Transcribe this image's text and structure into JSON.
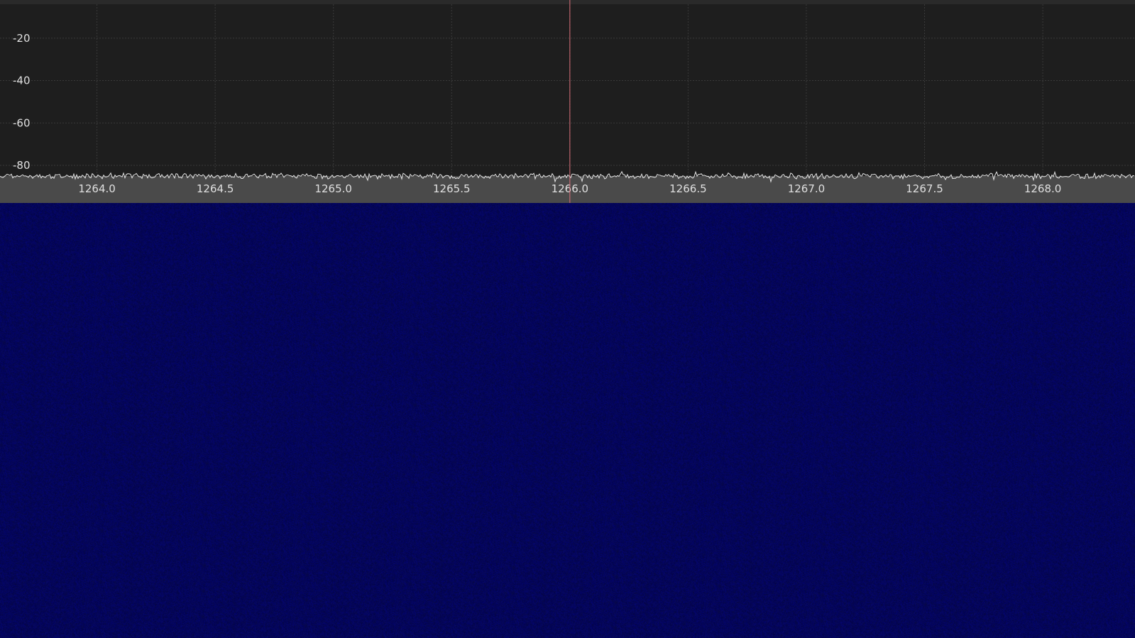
{
  "chart_data": {
    "type": "line",
    "x_ticks": [
      "1264.0",
      "1264.5",
      "1265.0",
      "1265.5",
      "1266.0",
      "1266.5",
      "1267.0",
      "1267.5",
      "1268.0"
    ],
    "x_tick_values": [
      1264.0,
      1264.5,
      1265.0,
      1265.5,
      1266.0,
      1266.5,
      1267.0,
      1267.5,
      1268.0
    ],
    "y_ticks": [
      "-20",
      "-40",
      "-60",
      "-80"
    ],
    "y_tick_values": [
      -20,
      -40,
      -60,
      -80
    ],
    "xlim": [
      1263.59,
      1268.39
    ],
    "ylim": [
      -85,
      -4
    ],
    "noise_floor": -85,
    "tuned_frequency": 1266.0,
    "grid": true,
    "colors": {
      "plot_background": "#1e1e1e",
      "axis_band": "#4a4a4a",
      "trace": "#e6e6e6",
      "cursor": "#d9707a",
      "grid": "#3a3a3a",
      "label": "#e0e0e0",
      "waterfall": "#03045c"
    }
  },
  "waterfall": {
    "label": "waterfall-display"
  }
}
